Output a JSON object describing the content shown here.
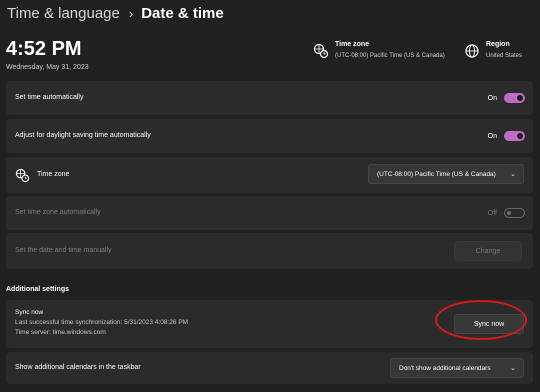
{
  "header": {
    "parent": "Time & language",
    "separator": "›",
    "current": "Date & time"
  },
  "clock": {
    "time": "4:52 PM",
    "date": "Wednesday, May 31, 2023"
  },
  "timezone_info": {
    "title": "Time zone",
    "value": "(UTC-08:00) Pacific Time (US & Canada)",
    "icon": "globe-clock-icon"
  },
  "region_info": {
    "title": "Region",
    "value": "United States",
    "icon": "globe-icon"
  },
  "settings": {
    "set_time_auto": {
      "label": "Set time automatically",
      "state": "On"
    },
    "daylight": {
      "label": "Adjust for daylight saving time automatically",
      "state": "On"
    },
    "time_zone": {
      "label": "Time zone",
      "value": "(UTC-08:00) Pacific Time (US & Canada)"
    },
    "set_tz_auto": {
      "label": "Set time zone automatically",
      "state": "Off"
    },
    "manual": {
      "label": "Set the date and time manually",
      "button": "Change"
    }
  },
  "additional": {
    "title": "Additional settings",
    "sync": {
      "title": "Sync now",
      "last_sync": "Last successful time synchronization: 5/31/2023 4:08:26 PM",
      "server": "Time server: time.windows.com",
      "button": "Sync now"
    },
    "calendars": {
      "label": "Show additional calendars in the taskbar",
      "value": "Don't show additional calendars"
    }
  },
  "colors": {
    "accent": "#c26bc4",
    "annotation": "#d11a1a",
    "background": "#202020",
    "card": "#2b2b2b"
  }
}
